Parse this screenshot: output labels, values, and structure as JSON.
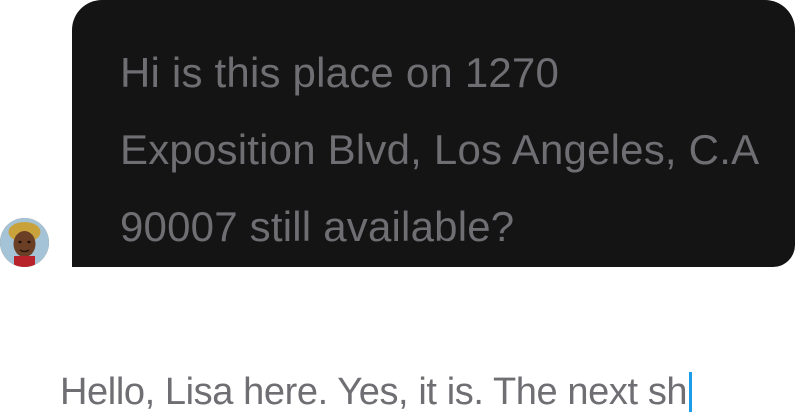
{
  "conversation": {
    "incoming_message": {
      "text": "Hi is this place on 1270 Exposition Blvd, Los Angeles, C.A 90007 still available?"
    }
  },
  "composer": {
    "draft_text": "Hello, Lisa here. Yes, it is. The next sh"
  },
  "colors": {
    "bubble_background": "#141414",
    "message_text": "#6e6e73",
    "caret": "#1a9ee8",
    "page_background": "#ffffff"
  },
  "icons": {
    "sender_avatar": "avatar"
  }
}
